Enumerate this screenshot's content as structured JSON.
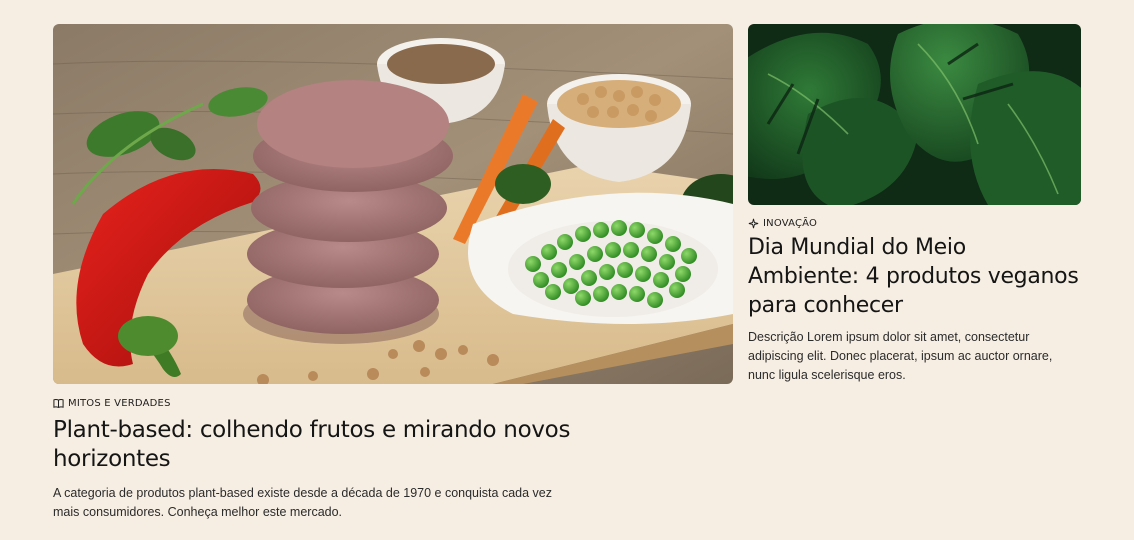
{
  "articles": {
    "main": {
      "image_alt": "Hambúrgueres vegetais empilhados com ervilhas, cenouras, grão-de-bico e pimentão vermelho",
      "tag_icon": "book-icon",
      "tag": "MITOS E VERDADES",
      "title": "Plant-based: colhendo frutos e mirando novos horizontes",
      "description": "A categoria de produtos plant-based existe desde a década de 1970 e conquista cada vez mais consumidores. Conheça melhor este mercado."
    },
    "side": {
      "image_alt": "Folhas de costela-de-adão verdes",
      "tag_icon": "sparkle-icon",
      "tag": "INOVAÇÃO",
      "title": "Dia Mundial do Meio Ambiente: 4 produtos veganos para conhecer",
      "description": "Descrição Lorem ipsum dolor sit amet, consectetur adipiscing elit. Donec placerat, ipsum ac auctor ornare, nunc ligula scelerisque eros."
    }
  },
  "colors": {
    "background": "#f6eee3",
    "text": "#1e1e1e"
  }
}
